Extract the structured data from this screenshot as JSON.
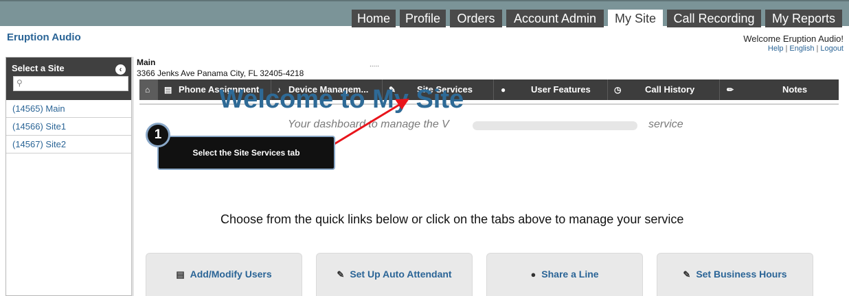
{
  "top_nav": {
    "tabs": [
      "Home",
      "Profile",
      "Orders",
      "Account Admin",
      "My Site",
      "Call Recording",
      "My Reports"
    ],
    "active": "My Site"
  },
  "header": {
    "brand": "Eruption Audio",
    "welcome": "Welcome Eruption Audio!",
    "links": [
      "Help",
      "English",
      "Logout"
    ]
  },
  "sidebar": {
    "title": "Select a Site",
    "sites": [
      "(14565) Main",
      "(14566) Site1",
      "(14567) Site2"
    ]
  },
  "site": {
    "name": "Main",
    "address": "3366 Jenks Ave Panama City, FL 32405-4218",
    "dots": "....."
  },
  "site_tabs": [
    "Phone Assignment",
    "Device Managem...",
    "Site Services",
    "User Features",
    "Call History",
    "Notes"
  ],
  "hero": {
    "title": "Welcome to My Site",
    "subtitle_start": "Your dashboard to manage the V",
    "subtitle_end": "service",
    "quick_links_text": "Choose from the quick links below or click on the tabs above to manage your service"
  },
  "quick_links": [
    "Add/Modify Users",
    "Set Up Auto Attendant",
    "Share a Line",
    "Set Business Hours"
  ],
  "callout": {
    "step": "1",
    "text": "Select the Site Services tab"
  },
  "colors": {
    "top_nav_bg": "#7b9498",
    "tab_bg": "#4a4a4a",
    "link_blue": "#2a6496",
    "hero_blue": "#2e6a96",
    "arrow_red": "#e8141b"
  }
}
